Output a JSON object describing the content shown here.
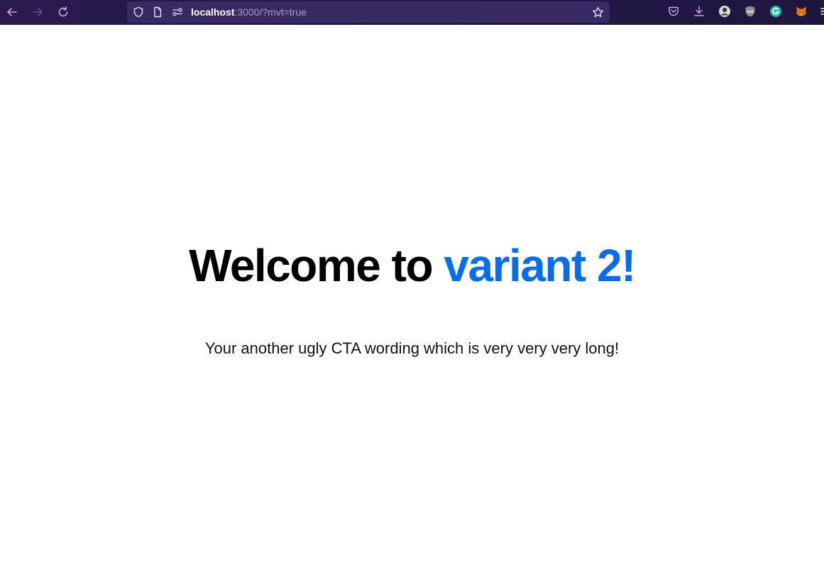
{
  "browser": {
    "url_host": "localhost",
    "url_rest": ":3000/?mvt=true",
    "icons": {
      "back": "arrow-left-icon",
      "forward": "arrow-right-icon",
      "reload": "reload-icon",
      "tracking": "shield-icon",
      "page_info": "page-icon",
      "permissions": "permissions-icon",
      "bookmark": "star-icon",
      "pocket": "pocket-icon",
      "downloads": "download-icon",
      "overflow": "menu-icon"
    },
    "extensions": [
      "avatar-extension",
      "ublock-extension",
      "grammarly-extension",
      "metamask-extension"
    ]
  },
  "page": {
    "headline_prefix": "Welcome to ",
    "headline_accent": "variant 2!",
    "cta_text": "Your another ugly CTA wording which is very very very long!"
  },
  "colors": {
    "accent": "#0a6ce8",
    "toolbar": "#2b1a4e",
    "icon_purple": "#c9a4f7"
  }
}
